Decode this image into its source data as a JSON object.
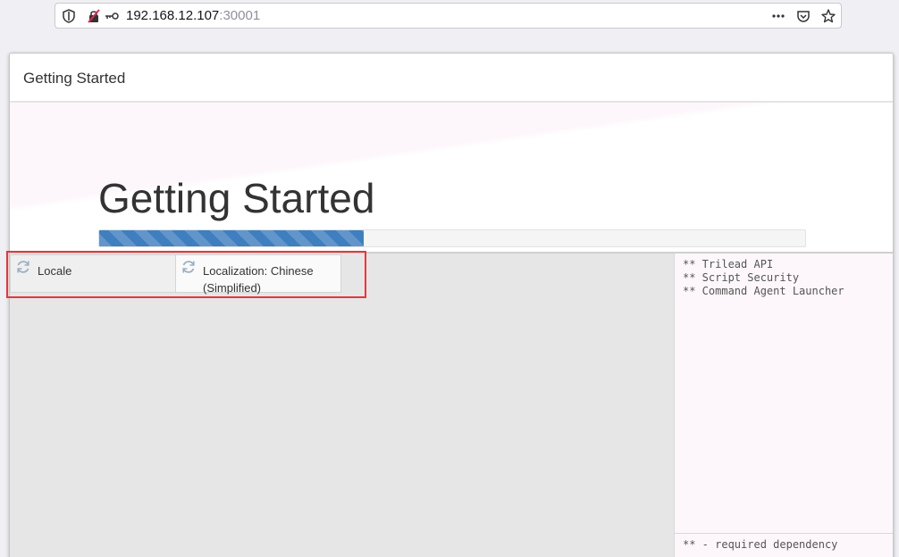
{
  "browser": {
    "url_host": "192.168.12.107",
    "url_port": ":30001",
    "icons": [
      "shield-icon",
      "insecure-lock-icon",
      "key-icon",
      "more-icon",
      "pocket-icon",
      "bookmark-star-icon"
    ]
  },
  "dialog": {
    "title": "Getting Started",
    "hero_title": "Getting Started",
    "progress_fraction": 0.375
  },
  "plugins": [
    {
      "name": "Locale",
      "status_icon": "loading-spinner-icon"
    },
    {
      "name": "Localization: Chinese (Simplified)",
      "status_icon": "loading-spinner-icon"
    }
  ],
  "log": {
    "lines": "** Trilead API\n** Script Security\n** Command Agent Launcher",
    "footer": "** - required dependency"
  },
  "colors": {
    "progress": "#3f7fbf",
    "highlight": "#e5373c"
  }
}
